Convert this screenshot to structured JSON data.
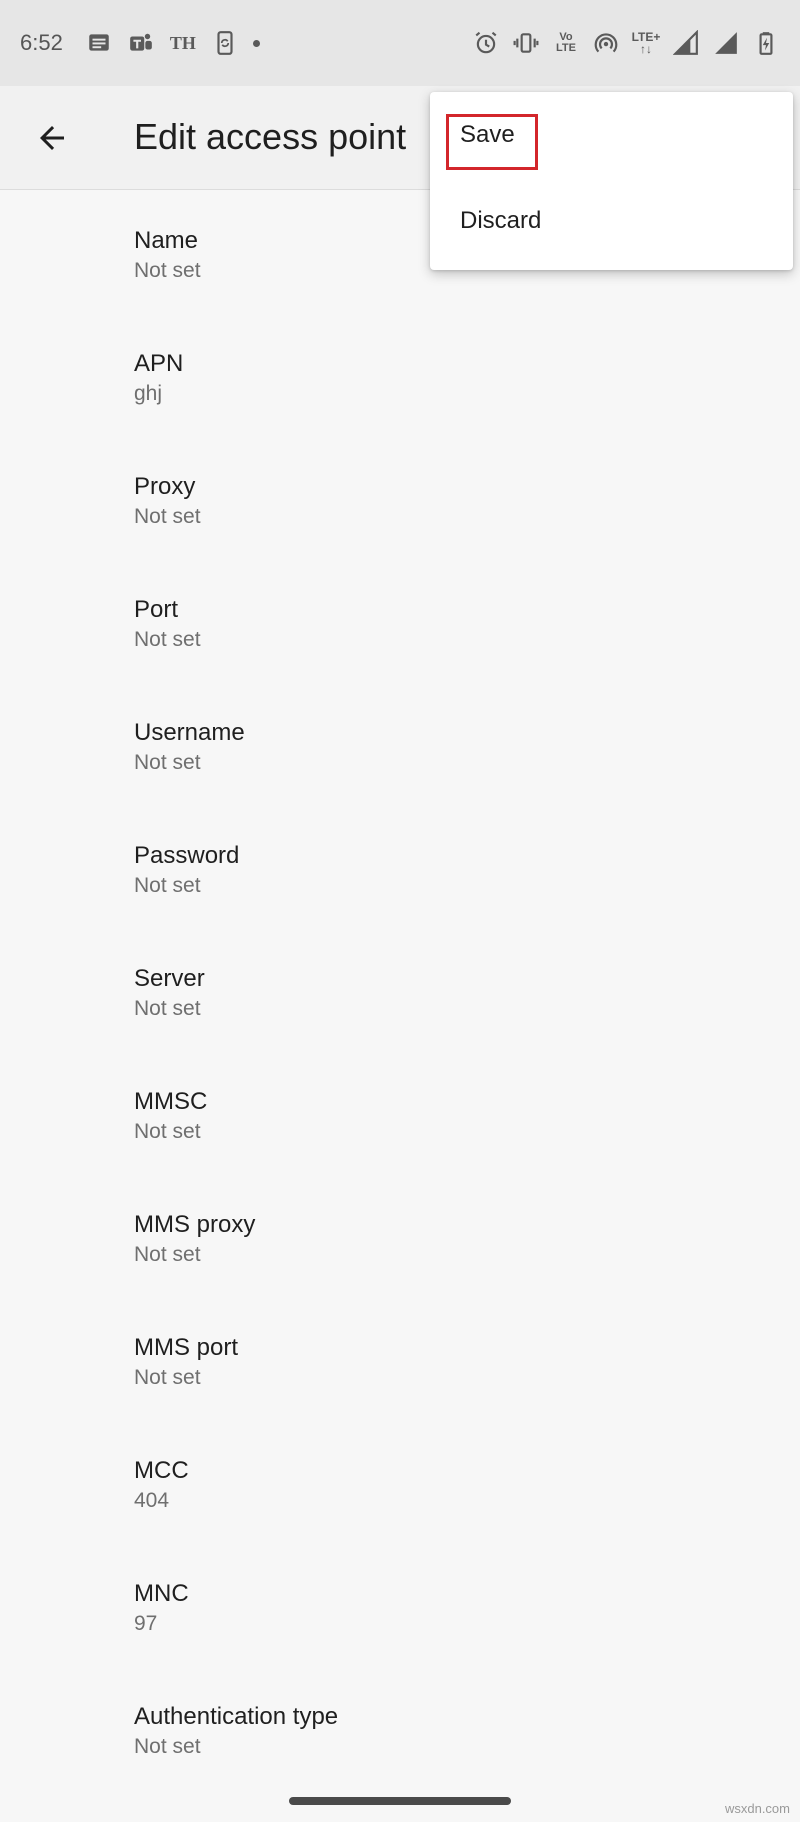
{
  "status_bar": {
    "time": "6:52",
    "th_label": "TH",
    "volte_top": "Vo",
    "volte_bottom": "LTE",
    "lte_label": "LTE+"
  },
  "app_bar": {
    "title": "Edit access point"
  },
  "menu": {
    "save_label": "Save",
    "discard_label": "Discard",
    "highlight_color": "#d3262b"
  },
  "preferences": [
    {
      "title": "Name",
      "summary": "Not set"
    },
    {
      "title": "APN",
      "summary": "ghj"
    },
    {
      "title": "Proxy",
      "summary": "Not set"
    },
    {
      "title": "Port",
      "summary": "Not set"
    },
    {
      "title": "Username",
      "summary": "Not set"
    },
    {
      "title": "Password",
      "summary": "Not set"
    },
    {
      "title": "Server",
      "summary": "Not set"
    },
    {
      "title": "MMSC",
      "summary": "Not set"
    },
    {
      "title": "MMS proxy",
      "summary": "Not set"
    },
    {
      "title": "MMS port",
      "summary": "Not set"
    },
    {
      "title": "MCC",
      "summary": "404"
    },
    {
      "title": "MNC",
      "summary": "97"
    },
    {
      "title": "Authentication type",
      "summary": "Not set"
    }
  ],
  "watermark": "wsxdn.com",
  "colors": {
    "status_bar_bg": "#e6e6e6",
    "app_bar_bg": "#f1f1f1",
    "page_bg": "#f7f7f7",
    "summary_text": "#6f6f6f"
  }
}
